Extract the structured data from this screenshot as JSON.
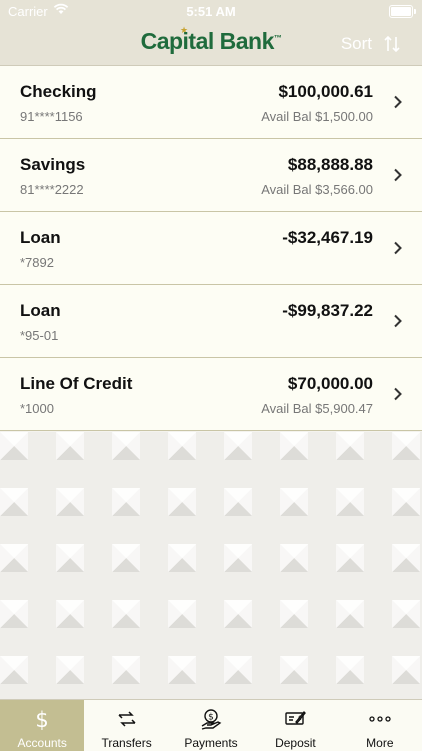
{
  "status_bar": {
    "carrier": "Carrier",
    "time": "5:51 AM"
  },
  "header": {
    "logo_text": "Capital Bank",
    "logo_tm": "™",
    "sort_label": "Sort"
  },
  "accounts": [
    {
      "name": "Checking",
      "number": "91****1156",
      "balance": "$100,000.61",
      "avail": "Avail Bal $1,500.00"
    },
    {
      "name": "Savings",
      "number": "81****2222",
      "balance": "$88,888.88",
      "avail": "Avail Bal $3,566.00"
    },
    {
      "name": "Loan",
      "number": "*7892",
      "balance": "-$32,467.19",
      "avail": ""
    },
    {
      "name": "Loan",
      "number": "*95-01",
      "balance": "-$99,837.22",
      "avail": ""
    },
    {
      "name": "Line Of Credit",
      "number": "*1000",
      "balance": "$70,000.00",
      "avail": "Avail Bal $5,900.47"
    }
  ],
  "tabs": [
    {
      "label": "Accounts",
      "icon": "dollar-icon",
      "active": true
    },
    {
      "label": "Transfers",
      "icon": "transfer-icon",
      "active": false
    },
    {
      "label": "Payments",
      "icon": "payment-icon",
      "active": false
    },
    {
      "label": "Deposit",
      "icon": "check-deposit-icon",
      "active": false
    },
    {
      "label": "More",
      "icon": "more-icon",
      "active": false
    }
  ],
  "colors": {
    "brand_green": "#1f6b3c",
    "brand_gold": "#c8a433",
    "active_tab": "#c3be92",
    "header_bg": "#e6e3d6"
  }
}
